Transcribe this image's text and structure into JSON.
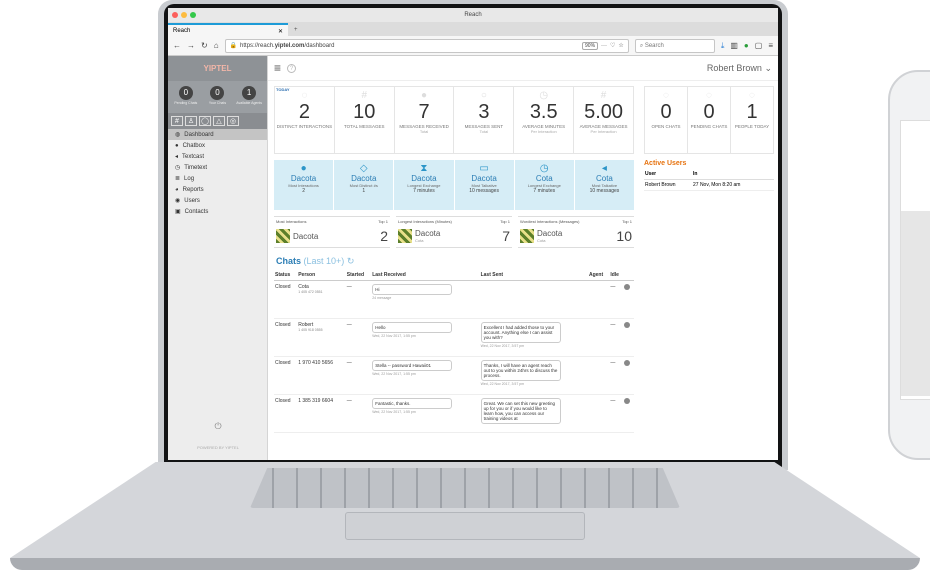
{
  "browser": {
    "window_title": "Reach",
    "tab_label": "Reach",
    "new_tab": "+",
    "url_prefix": "https://reach.",
    "url_domain": "yiptel.com",
    "url_path": "/dashboard",
    "zoom": "90%",
    "search_placeholder": "Search"
  },
  "sidebar": {
    "logo": "YIPTEL",
    "counters": [
      {
        "value": "0",
        "label": "Pending Chats"
      },
      {
        "value": "0",
        "label": "Your Chats"
      },
      {
        "value": "1",
        "label": "Available Agents"
      }
    ],
    "nav": [
      {
        "label": "Dashboard",
        "active": true
      },
      {
        "label": "Chatbox"
      },
      {
        "label": "Textcast"
      },
      {
        "label": "Timetext"
      },
      {
        "label": "Log"
      },
      {
        "label": "Reports"
      },
      {
        "label": "Users"
      },
      {
        "label": "Contacts"
      }
    ],
    "powered": "POWERED BY YIPTEL"
  },
  "header": {
    "user": "Robert Brown"
  },
  "today_label": "TODAY",
  "stats": [
    {
      "value": "2",
      "label": "DISTINCT INTERACTIONS",
      "sub": ""
    },
    {
      "value": "10",
      "label": "TOTAL MESSAGES",
      "sub": ""
    },
    {
      "value": "7",
      "label": "MESSAGES RECEIVED",
      "sub": "Total"
    },
    {
      "value": "3",
      "label": "MESSAGES SENT",
      "sub": "Total"
    },
    {
      "value": "3.5",
      "label": "AVERAGE MINUTES",
      "sub": "Per Interaction"
    },
    {
      "value": "5.00",
      "label": "AVERAGE MESSAGES",
      "sub": "Per Interaction"
    }
  ],
  "stats_right": [
    {
      "value": "0",
      "label": "OPEN CHATS"
    },
    {
      "value": "0",
      "label": "PENDING CHATS"
    },
    {
      "value": "1",
      "label": "PEOPLE TODAY"
    }
  ],
  "features": [
    {
      "name": "Dacota",
      "label": "Most Interactions",
      "value": "2"
    },
    {
      "name": "Dacota",
      "label": "Most Distinct #s",
      "value": "1"
    },
    {
      "name": "Dacota",
      "label": "Longest Exchange",
      "value": "7 minutes"
    },
    {
      "name": "Dacota",
      "label": "Most Talkative",
      "value": "10 messages"
    },
    {
      "name": "Cota",
      "label": "Longest Exchange",
      "value": "7 minutes"
    },
    {
      "name": "Cota",
      "label": "Most Talkative",
      "value": "10 messages"
    }
  ],
  "active_users": {
    "title": "Active Users",
    "col_user": "User",
    "col_in": "In",
    "rows": [
      {
        "user": "Robert Brown",
        "in": "27 Nov, Mon 8:20 am"
      }
    ]
  },
  "tops": [
    {
      "title": "Most Interactions",
      "top": "Top 1",
      "name": "Dacota",
      "sub": "",
      "num": "2"
    },
    {
      "title": "Longest Interactions (Minutes)",
      "top": "Top 1",
      "name": "Dacota",
      "sub": "Cota",
      "num": "7"
    },
    {
      "title": "Wordiest Interactions (Messages)",
      "top": "Top 1",
      "name": "Dacota",
      "sub": "Cota",
      "num": "10"
    }
  ],
  "chats": {
    "title": "Chats",
    "subtitle": "(Last 10+)",
    "columns": [
      "Status",
      "Person",
      "Started",
      "Last Received",
      "Last Sent",
      "Agent",
      "Idle"
    ],
    "rows": [
      {
        "status": "Closed",
        "person": "Cota",
        "phone": "1 405 472 0551",
        "started": "—",
        "received": "Hi",
        "received_meta": "24 message",
        "sent": "",
        "sent_meta": "",
        "agent": "",
        "idle": "—"
      },
      {
        "status": "Closed",
        "person": "Robert",
        "phone": "1 405 918 0555",
        "started": "—",
        "received": "Hello",
        "received_meta": "Wed, 22 Nov 2017, 1:55 pm",
        "sent": "Excellent I had added those to your account. Anything else I can assist you with?",
        "sent_meta": "Wed, 22 Nov 2017, 3:57 pm",
        "agent": "",
        "idle": "—"
      },
      {
        "status": "Closed",
        "person": "1 970 410 5656",
        "phone": "",
        "started": "—",
        "received": "Stella -- password Hawaii01",
        "received_meta": "Wed, 22 Nov 2017, 1:55 pm",
        "sent": "Thanks, I will have an agent reach out to you within 24hrs to discuss the process.",
        "sent_meta": "Wed, 22 Nov 2017, 3:57 pm",
        "agent": "",
        "idle": "—"
      },
      {
        "status": "Closed",
        "person": "1 385 319 6604",
        "phone": "",
        "started": "—",
        "received": "Fantastic, thanks.",
        "received_meta": "Wed, 22 Nov 2017, 1:55 pm",
        "sent": "Great. We can set this new greeting up for you or if you would like to learn how, you can access our training videos at",
        "sent_meta": "",
        "agent": "",
        "idle": "—"
      }
    ]
  }
}
